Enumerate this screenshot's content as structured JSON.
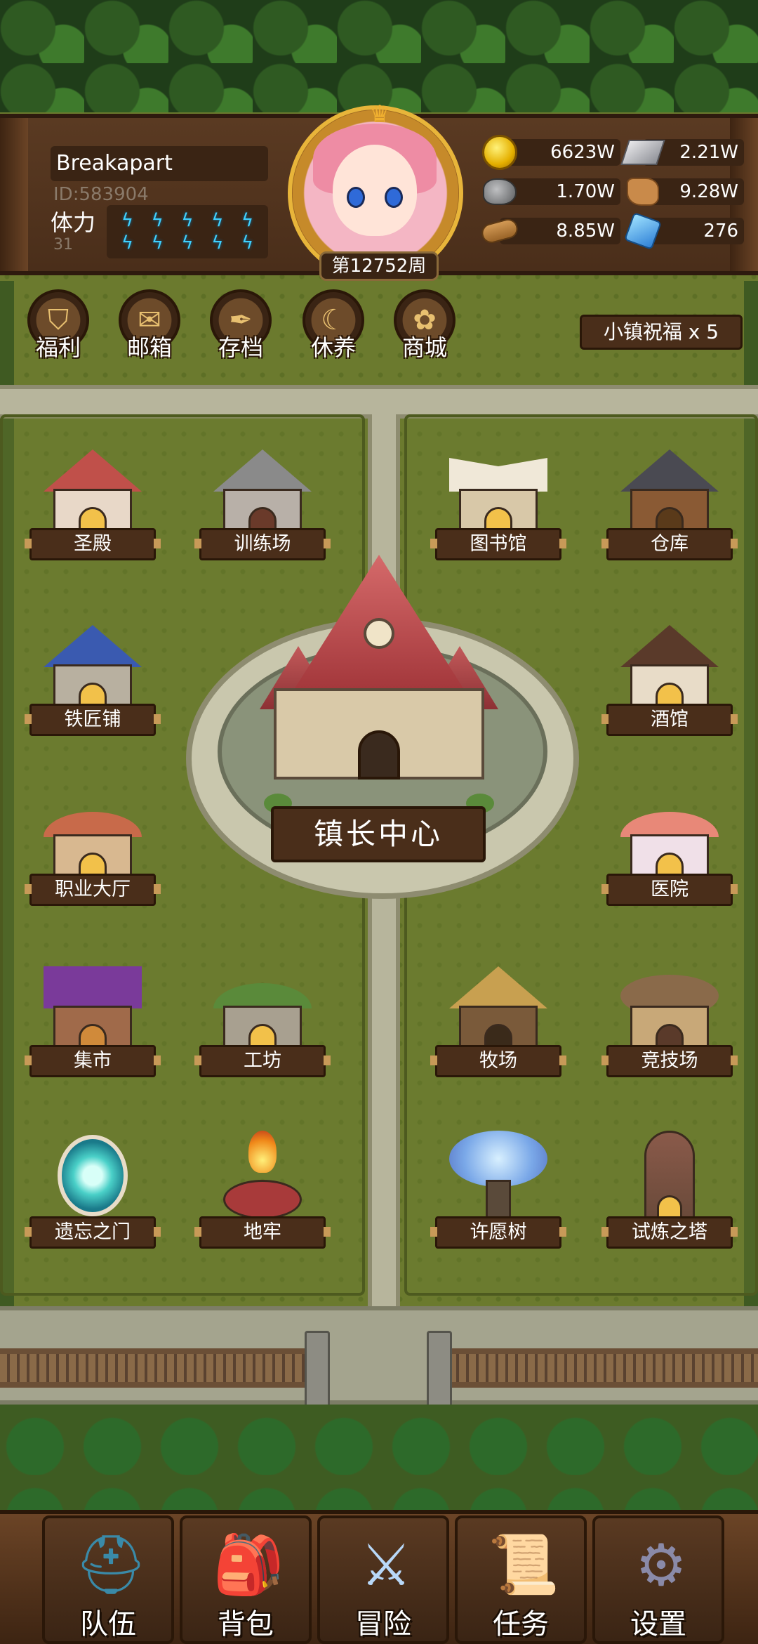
{
  "player": {
    "name": "Breakapart",
    "id_text": "ID:583904",
    "stamina_label": "体力",
    "stamina_value": "31",
    "stamina_bolts": 10,
    "week": "第12752周"
  },
  "resources": [
    {
      "name": "gold",
      "icon": "gold-coin-icon",
      "value": "6623W"
    },
    {
      "name": "iron-ingot",
      "icon": "iron-ingot-icon",
      "value": "2.21W"
    },
    {
      "name": "ore",
      "icon": "ore-icon",
      "value": "1.70W"
    },
    {
      "name": "leather",
      "icon": "leather-icon",
      "value": "9.28W"
    },
    {
      "name": "wood",
      "icon": "wood-log-icon",
      "value": "8.85W"
    },
    {
      "name": "crystal",
      "icon": "crystal-icon",
      "value": "276"
    }
  ],
  "menu": [
    {
      "label": "福利",
      "icon": "shield-icon"
    },
    {
      "label": "邮箱",
      "icon": "mail-icon"
    },
    {
      "label": "存档",
      "icon": "scroll-quill-icon"
    },
    {
      "label": "休养",
      "icon": "rest-scroll-icon"
    },
    {
      "label": "商城",
      "icon": "shop-bag-icon"
    }
  ],
  "blessing": "小镇祝福 x 5",
  "buildings": {
    "shengdian": "圣殿",
    "xunlianchang": "训练场",
    "tushuguan": "图书馆",
    "cangku": "仓库",
    "tiejiangpu": "铁匠铺",
    "jiuguan": "酒馆",
    "zhiyedating": "职业大厅",
    "yiyuan": "医院",
    "jishi": "集市",
    "gongfang": "工坊",
    "muchang": "牧场",
    "jingjichang": "竞技场",
    "yiwangzhimen": "遗忘之门",
    "dilao": "地牢",
    "xuyuanshu": "许愿树",
    "shilianzhita": "试炼之塔"
  },
  "town_hall": "镇长中心",
  "nav": [
    {
      "label": "队伍",
      "icon": "helmet-icon"
    },
    {
      "label": "背包",
      "icon": "backpack-icon"
    },
    {
      "label": "冒险",
      "icon": "crossed-swords-icon"
    },
    {
      "label": "任务",
      "icon": "quest-scroll-icon"
    },
    {
      "label": "设置",
      "icon": "gear-icon"
    }
  ],
  "colors": {
    "panel_brown": "#4a2e1a",
    "grass": "#6b7a2e",
    "road": "#b7b59c",
    "stamina_bolt": "#3fd0ff"
  }
}
